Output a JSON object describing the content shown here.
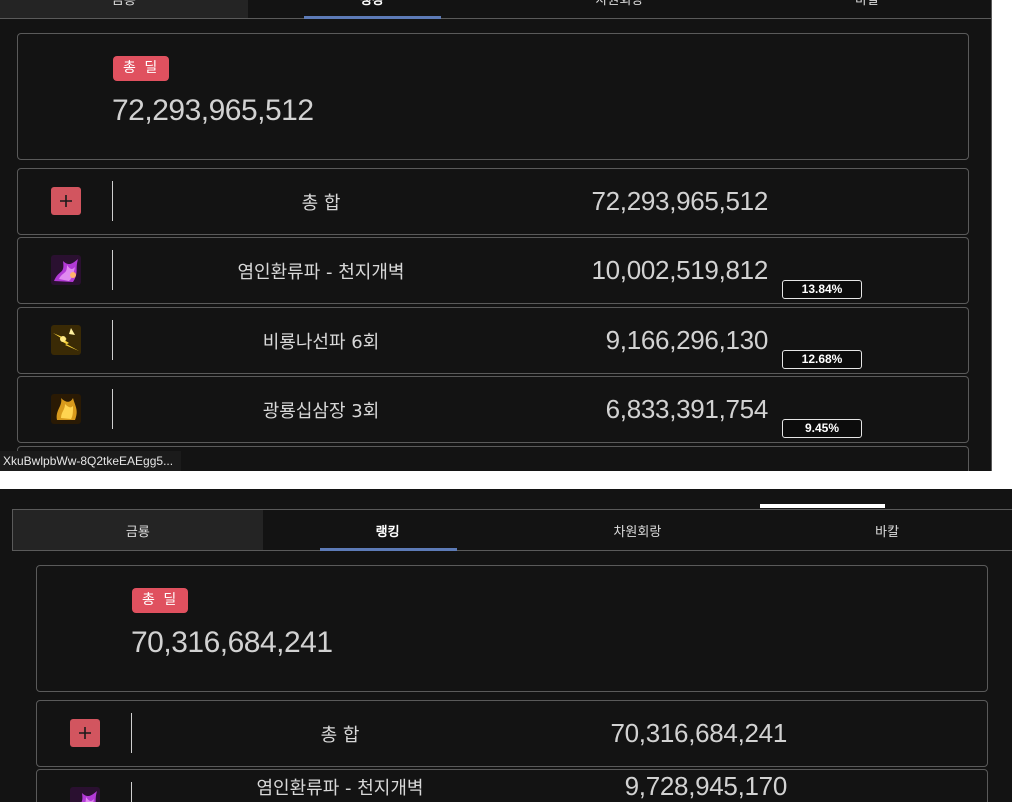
{
  "colors": {
    "accent_blue": "#5d7bb7",
    "badge_red": "#e0515f",
    "panel_bg": "#131313",
    "border": "#5a5a5a"
  },
  "top": {
    "tabs": [
      {
        "label": "금룡"
      },
      {
        "label": "랭킹"
      },
      {
        "label": "차원회랑"
      },
      {
        "label": "바칼"
      }
    ],
    "total": {
      "badge": "총 딜",
      "value": "72,293,965,512"
    },
    "summary": {
      "name": "총 합",
      "value": "72,293,965,512",
      "icon": "plus-icon"
    },
    "skills": [
      {
        "name": "염인환류파 - 천지개벽",
        "value": "10,002,519,812",
        "percent": "13.84%",
        "icon": "purple-flame-skill-icon"
      },
      {
        "name": "비룡나선파 6회",
        "value": "9,166,296,130",
        "percent": "12.68%",
        "icon": "yellow-lightning-skill-icon"
      },
      {
        "name": "광룡십삼장 3회",
        "value": "6,833,391,754",
        "percent": "9.45%",
        "icon": "golden-dragon-skill-icon"
      }
    ],
    "tooltip": "XkuBwlpbWw-8Q2tkeEAEgg5..."
  },
  "bottom": {
    "tabs": [
      {
        "label": "금룡"
      },
      {
        "label": "랭킹"
      },
      {
        "label": "차원회랑"
      },
      {
        "label": "바칼"
      }
    ],
    "total": {
      "badge": "총 딜",
      "value": "70,316,684,241"
    },
    "summary": {
      "name": "총 합",
      "value": "70,316,684,241",
      "icon": "plus-icon"
    },
    "skills": [
      {
        "name": "염인환류파 - 천지개벽",
        "value": "9,728,945,170",
        "icon": "purple-flame-skill-icon"
      }
    ]
  }
}
